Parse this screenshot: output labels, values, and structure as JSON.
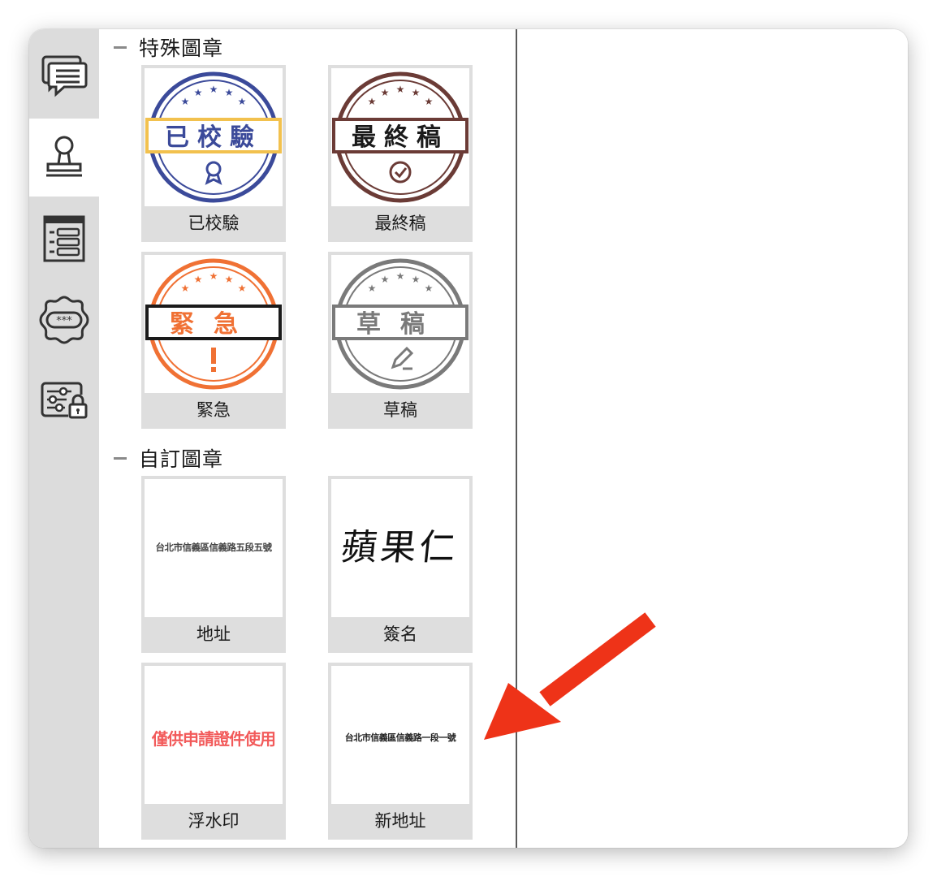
{
  "sidebar": {
    "items": [
      {
        "name": "comments-icon"
      },
      {
        "name": "stamp-icon",
        "active": true
      },
      {
        "name": "form-list-icon"
      },
      {
        "name": "badge-password-icon"
      },
      {
        "name": "settings-lock-icon"
      }
    ]
  },
  "sections": {
    "special": {
      "title": "特殊圖章",
      "stamps": [
        {
          "label": "已校驗",
          "stamp_text": "已校驗",
          "color": "#3b4a9a",
          "band": "#f2c14e"
        },
        {
          "label": "最終稿",
          "stamp_text": "最終稿",
          "color": "#6b3b36",
          "band": "#6b3b36"
        },
        {
          "label": "緊急",
          "stamp_text": "緊急",
          "color": "#f07134",
          "band": "#1a1a1a"
        },
        {
          "label": "草稿",
          "stamp_text": "草稿",
          "color": "#7a7a7a",
          "band": "#7a7a7a"
        }
      ]
    },
    "custom": {
      "title": "自訂圖章",
      "stamps": [
        {
          "label": "地址",
          "stamp_text": "台北市信義區信義路五段五號"
        },
        {
          "label": "簽名",
          "stamp_text": "蘋果仁"
        },
        {
          "label": "浮水印",
          "stamp_text": "僅供申請證件使用",
          "color": "#f25a5a"
        },
        {
          "label": "新地址",
          "stamp_text": "台北市信義區信義路一段一號"
        }
      ]
    }
  },
  "annotation": {
    "color": "#ee3318"
  }
}
